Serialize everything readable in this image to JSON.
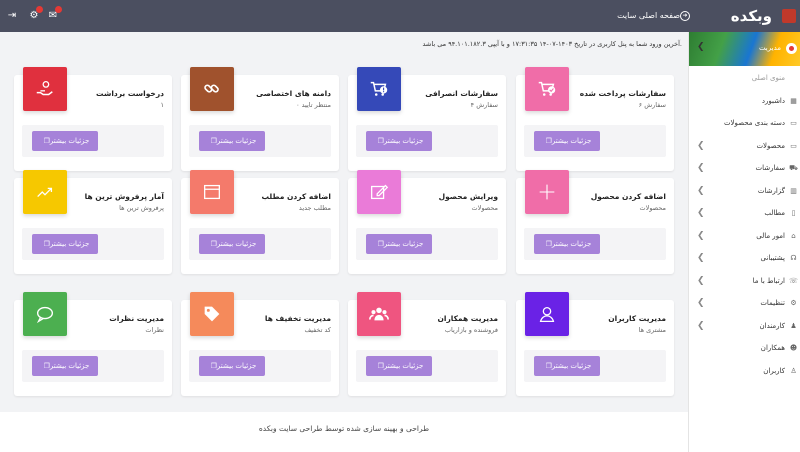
{
  "topbar": {
    "logo": "وبکده",
    "home_link": "صفحه اصلی سایت"
  },
  "sidebar": {
    "user_label": "مدیریت",
    "items": [
      {
        "label": "منوی اصلی",
        "icon": "",
        "has_chevron": false,
        "muted": true
      },
      {
        "label": "داشبورد",
        "icon": "dashboard-icon",
        "has_chevron": false
      },
      {
        "label": "دسته بندی محصولات",
        "icon": "folder-icon",
        "has_chevron": false
      },
      {
        "label": "محصولات",
        "icon": "folder-icon",
        "has_chevron": true
      },
      {
        "label": "سفارشات",
        "icon": "cart-icon",
        "has_chevron": true
      },
      {
        "label": "گزارشات",
        "icon": "bar-chart-icon",
        "has_chevron": true
      },
      {
        "label": "مطالب",
        "icon": "file-icon",
        "has_chevron": true
      },
      {
        "label": "امور مالی",
        "icon": "bank-icon",
        "has_chevron": true
      },
      {
        "label": "پشتیبانی",
        "icon": "headset-icon",
        "has_chevron": true
      },
      {
        "label": "ارتباط با ما",
        "icon": "phone-icon",
        "has_chevron": true
      },
      {
        "label": "تنظیمات",
        "icon": "gear-icon",
        "has_chevron": true
      },
      {
        "label": "کارمندان",
        "icon": "user-tie-icon",
        "has_chevron": true
      },
      {
        "label": "همکاران",
        "icon": "users-icon",
        "has_chevron": false
      },
      {
        "label": "کاربران",
        "icon": "user-icon",
        "has_chevron": false
      }
    ]
  },
  "notice": "آخرین ورود شما به پنل کاربری در تاریخ ۱۴۰۳-۰۷-۱۴ ۱۷:۳۱:۳۵ و با آیپی ۹۴.۱۰۱.۱۸۲.۳ می باشد.",
  "button_label": "جزئیات بیشتر",
  "cards": [
    {
      "title": "سفارشات پرداخت شده",
      "sub": "۶ سفارش",
      "icon": "cart-check-icon",
      "color": "#f06da8"
    },
    {
      "title": "سفارشات انصرافی",
      "sub": "۴ سفارش",
      "icon": "cart-alert-icon",
      "color": "#3549b8"
    },
    {
      "title": "دامنه های اختصاصی",
      "sub": "منتظر تایید ۰",
      "icon": "link-icon",
      "color": "#a0522d"
    },
    {
      "title": "درخواست برداشت",
      "sub": "۱",
      "icon": "hand-money-icon",
      "color": "#e0303e"
    },
    {
      "title": "اضافه کردن محصول",
      "sub": "محصولات",
      "icon": "plus-icon",
      "color": "#f06da8"
    },
    {
      "title": "ویرایش محصول",
      "sub": "محصولات",
      "icon": "edit-icon",
      "color": "#ea7bd8"
    },
    {
      "title": "اضافه کردن مطلب",
      "sub": "مطلب جدید",
      "icon": "window-icon",
      "color": "#f47a6b"
    },
    {
      "title": "آمار پرفروش ترین ها",
      "sub": "پرفروش ترین ها",
      "icon": "trend-icon",
      "color": "#f6c800"
    },
    {
      "title": "مدیریت کاربران",
      "sub": "مشتری ها",
      "icon": "user-outline-icon",
      "color": "#6a22e6"
    },
    {
      "title": "مدیریت همکاران",
      "sub": "فروشنده و بازاریاب",
      "icon": "group-icon",
      "color": "#ef5580"
    },
    {
      "title": "مدیریت تخفیف ها",
      "sub": "کد تخفیف",
      "icon": "tag-icon",
      "color": "#f58a5b"
    },
    {
      "title": "مدیریت نظرات",
      "sub": "نظرات",
      "icon": "comment-icon",
      "color": "#4caf50"
    }
  ],
  "footer": "طراحی و بهینه سازی شده توسط طراحی سایت وبکده"
}
